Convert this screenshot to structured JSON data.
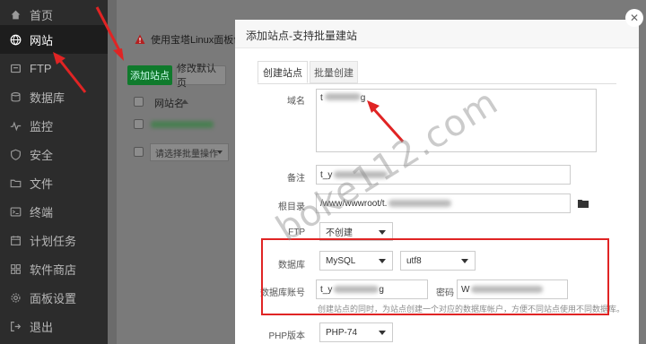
{
  "sidebar": {
    "items": [
      {
        "label": "首页",
        "icon": "home-icon"
      },
      {
        "label": "网站",
        "icon": "globe-icon"
      },
      {
        "label": "FTP",
        "icon": "ftp-icon"
      },
      {
        "label": "数据库",
        "icon": "database-icon"
      },
      {
        "label": "监控",
        "icon": "monitor-icon"
      },
      {
        "label": "安全",
        "icon": "shield-icon"
      },
      {
        "label": "文件",
        "icon": "folder-icon"
      },
      {
        "label": "终端",
        "icon": "terminal-icon"
      },
      {
        "label": "计划任务",
        "icon": "calendar-icon"
      },
      {
        "label": "软件商店",
        "icon": "apps-icon"
      },
      {
        "label": "面板设置",
        "icon": "gear-icon"
      },
      {
        "label": "退出",
        "icon": "logout-icon"
      }
    ],
    "active_index": 1
  },
  "main": {
    "warning": "使用宝塔Linux面板创建站",
    "add_site_label": "添加站点",
    "modify_default_label": "修改默认页",
    "col_site_name": "网站名",
    "batch_placeholder": "请选择批量操作"
  },
  "modal": {
    "title": "添加站点-支持批量建站",
    "tabs": [
      "创建站点",
      "批量创建"
    ],
    "domain_label": "域名",
    "domain_value": "t",
    "domain_value_tail": "g",
    "remark_label": "备注",
    "remark_value": "t_y",
    "root_label": "根目录",
    "root_value": "/www/wwwroot/t.",
    "ftp_label": "FTP",
    "ftp_value": "不创建",
    "db_label": "数据库",
    "db_type": "MySQL",
    "db_charset": "utf8",
    "db_user_label": "数据库账号",
    "db_user_value": "t_y",
    "db_user_tail": "g",
    "password_label": "密码",
    "password_value": "W",
    "db_hint": "创建站点的同时，为站点创建一个对应的数据库帐户，方便不同站点使用不同数据库。",
    "php_label": "PHP版本",
    "php_value": "PHP-74"
  },
  "watermark": "boke112.com",
  "colors": {
    "accent": "#20a53a",
    "highlight_box": "#e02424",
    "sidebar_bg": "#2c2c2c"
  }
}
